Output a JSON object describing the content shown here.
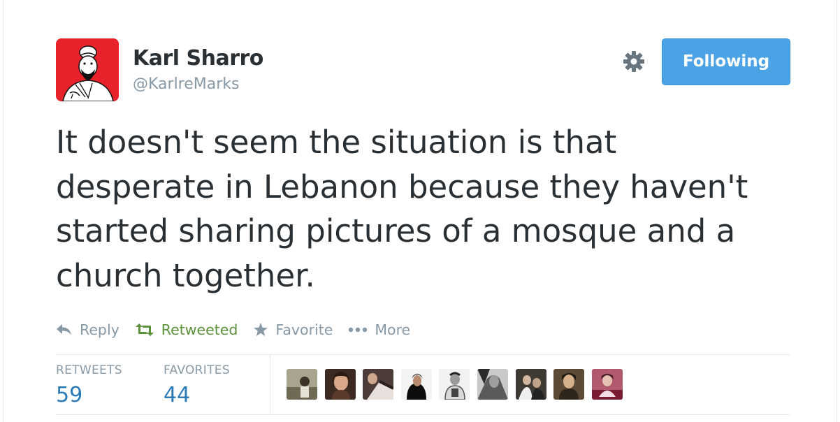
{
  "author": {
    "name": "Karl Sharro",
    "handle": "@KarlreMarks"
  },
  "follow_button": {
    "label": "Following"
  },
  "tweet": {
    "lines": [
      "It doesn't seem the situation is that",
      "desperate in Lebanon because they haven't",
      "started sharing pictures of a mosque and a",
      "church together."
    ]
  },
  "actions": {
    "reply": "Reply",
    "retweeted": "Retweeted",
    "favorite": "Favorite",
    "more": "More"
  },
  "stats": {
    "retweets_label": "RETWEETS",
    "retweets": "59",
    "favorites_label": "FAVORITES",
    "favorites": "44"
  },
  "colors": {
    "accent": "#4ba3e6",
    "retweet_green": "#5c913b",
    "link_blue": "#2b7bb9",
    "muted": "#8899a6"
  }
}
